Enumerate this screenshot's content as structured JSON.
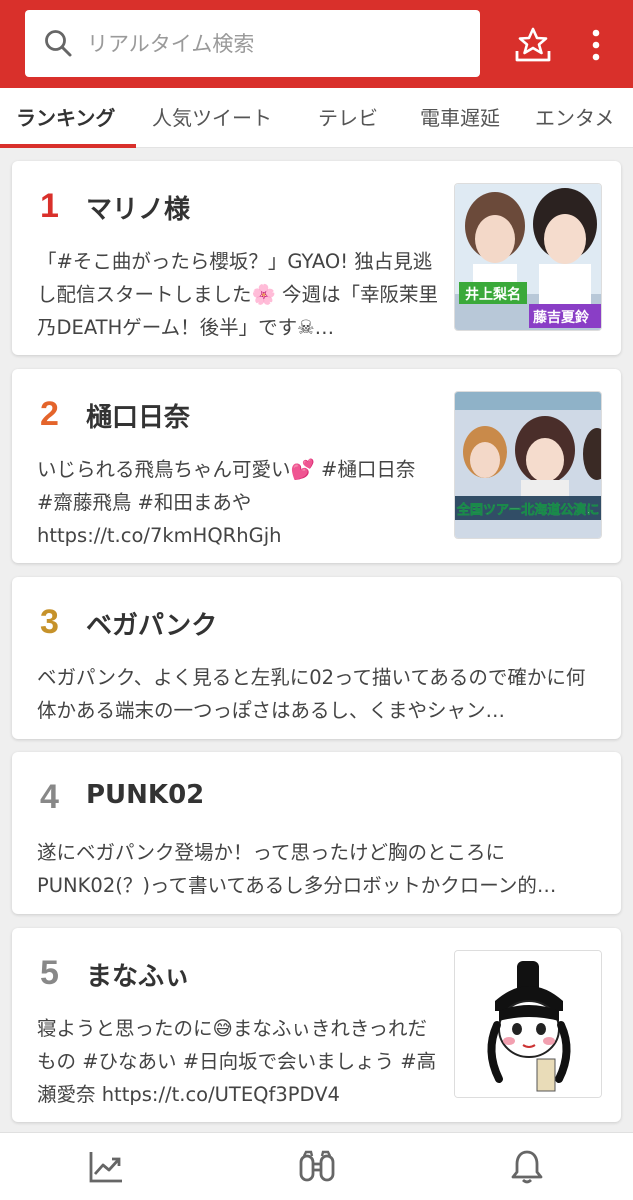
{
  "search": {
    "placeholder": "リアルタイム検索",
    "value": ""
  },
  "header": {
    "star_icon": "star-tray-icon",
    "menu_icon": "more-vertical-icon"
  },
  "tabs": [
    {
      "label": "ランキング",
      "active": true
    },
    {
      "label": "人気ツイート",
      "active": false
    },
    {
      "label": "テレビ",
      "active": false
    },
    {
      "label": "電車遅延",
      "active": false
    },
    {
      "label": "エンタメ",
      "active": false
    }
  ],
  "ranking": [
    {
      "rank": "1",
      "title": "マリノ様",
      "rank_color": "#d9302b",
      "desc": "「#そこ曲がったら櫻坂？」GYAO! 独占見逃し配信スタートしました🌸 今週は「幸阪茉里乃DEATHゲーム！後半」です☠…",
      "thumb": {
        "caption_left": "井上梨名",
        "caption_right": "藤吉夏鈴"
      }
    },
    {
      "rank": "2",
      "title": "樋口日奈",
      "rank_color": "#e4642b",
      "desc": "いじられる飛鳥ちゃん可愛い💕 #樋口日奈 #齋藤飛鳥 #和田まあや https://t.co/7kmHQRhGjh",
      "thumb": {
        "caption": "全国ツアー北海道公演に"
      }
    },
    {
      "rank": "3",
      "title": "ベガパンク",
      "rank_color": "#c6922a",
      "desc": "ベガパンク、よく見ると左乳に02って描いてあるので確かに何体かある端末の一つっぽさはあるし、くまやシャン…"
    },
    {
      "rank": "4",
      "title": "PUNK02",
      "rank_color": "#888888",
      "desc": "遂にベガパンク登場か！って思ったけど胸のところにPUNK02(？)って書いてあるし多分ロボットかクローン的…"
    },
    {
      "rank": "5",
      "title": "まなふぃ",
      "rank_color": "#888888",
      "desc": "寝ようと思ったのに😅まなふぃきれきっれだもの #ひなあい #日向坂で会いましょう #高瀬愛奈 https://t.co/UTEQf3PDV4"
    }
  ],
  "bottom_nav": [
    {
      "icon": "trend-chart-icon"
    },
    {
      "icon": "binoculars-icon"
    },
    {
      "icon": "bell-icon"
    }
  ],
  "colors": {
    "brand_red": "#d9302b",
    "rank1": "#d9302b",
    "rank2": "#e4642b",
    "rank3": "#c6922a",
    "rank_other": "#888888"
  }
}
